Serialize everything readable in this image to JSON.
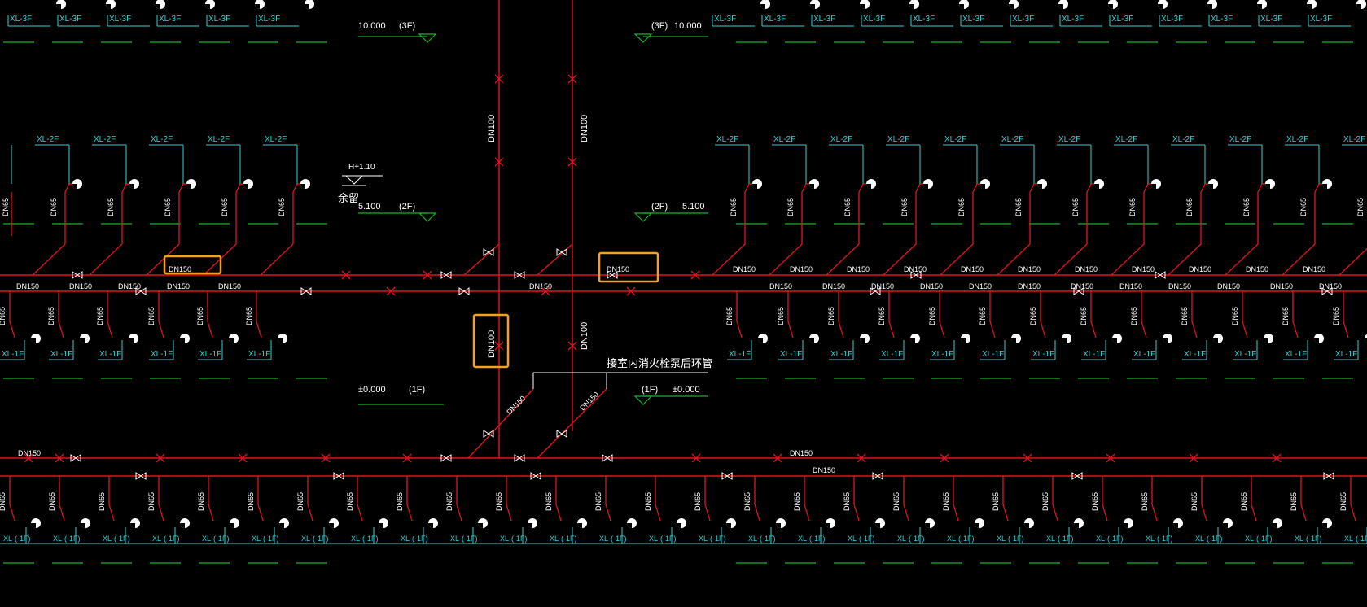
{
  "colors": {
    "background": "#000000",
    "pipe": "#e0141e",
    "riser_label": "#2fd3d3",
    "floor_line": "#1fae2a",
    "text": "#ffffff",
    "highlight": "#f5a21b"
  },
  "riser_labels": {
    "floor3": "XL-3F",
    "floor2": "XL-2F",
    "floor1": "XL-1F",
    "floorB1": "XL-(-1F)"
  },
  "pipe_labels": {
    "branch": "DN65",
    "main": "DN150",
    "vertical": "DN100",
    "diagonal": "DN150"
  },
  "elevations": {
    "f3_left": {
      "value": "10.000",
      "floor": "(3F)"
    },
    "f3_right": {
      "value": "10.000",
      "floor": "(3F)"
    },
    "f2_left": {
      "value": "5.100",
      "floor": "(2F)"
    },
    "f2_right": {
      "value": "5.100",
      "floor": "(2F)"
    },
    "f1_left": {
      "value": "±0.000",
      "floor": "(1F)"
    },
    "f1_right": {
      "value": "±0.000",
      "floor": "(1F)"
    }
  },
  "annotations": {
    "spare_height": "H+1.10",
    "spare_label": "余留",
    "connect_note": "接室内消火栓泵后环管"
  }
}
